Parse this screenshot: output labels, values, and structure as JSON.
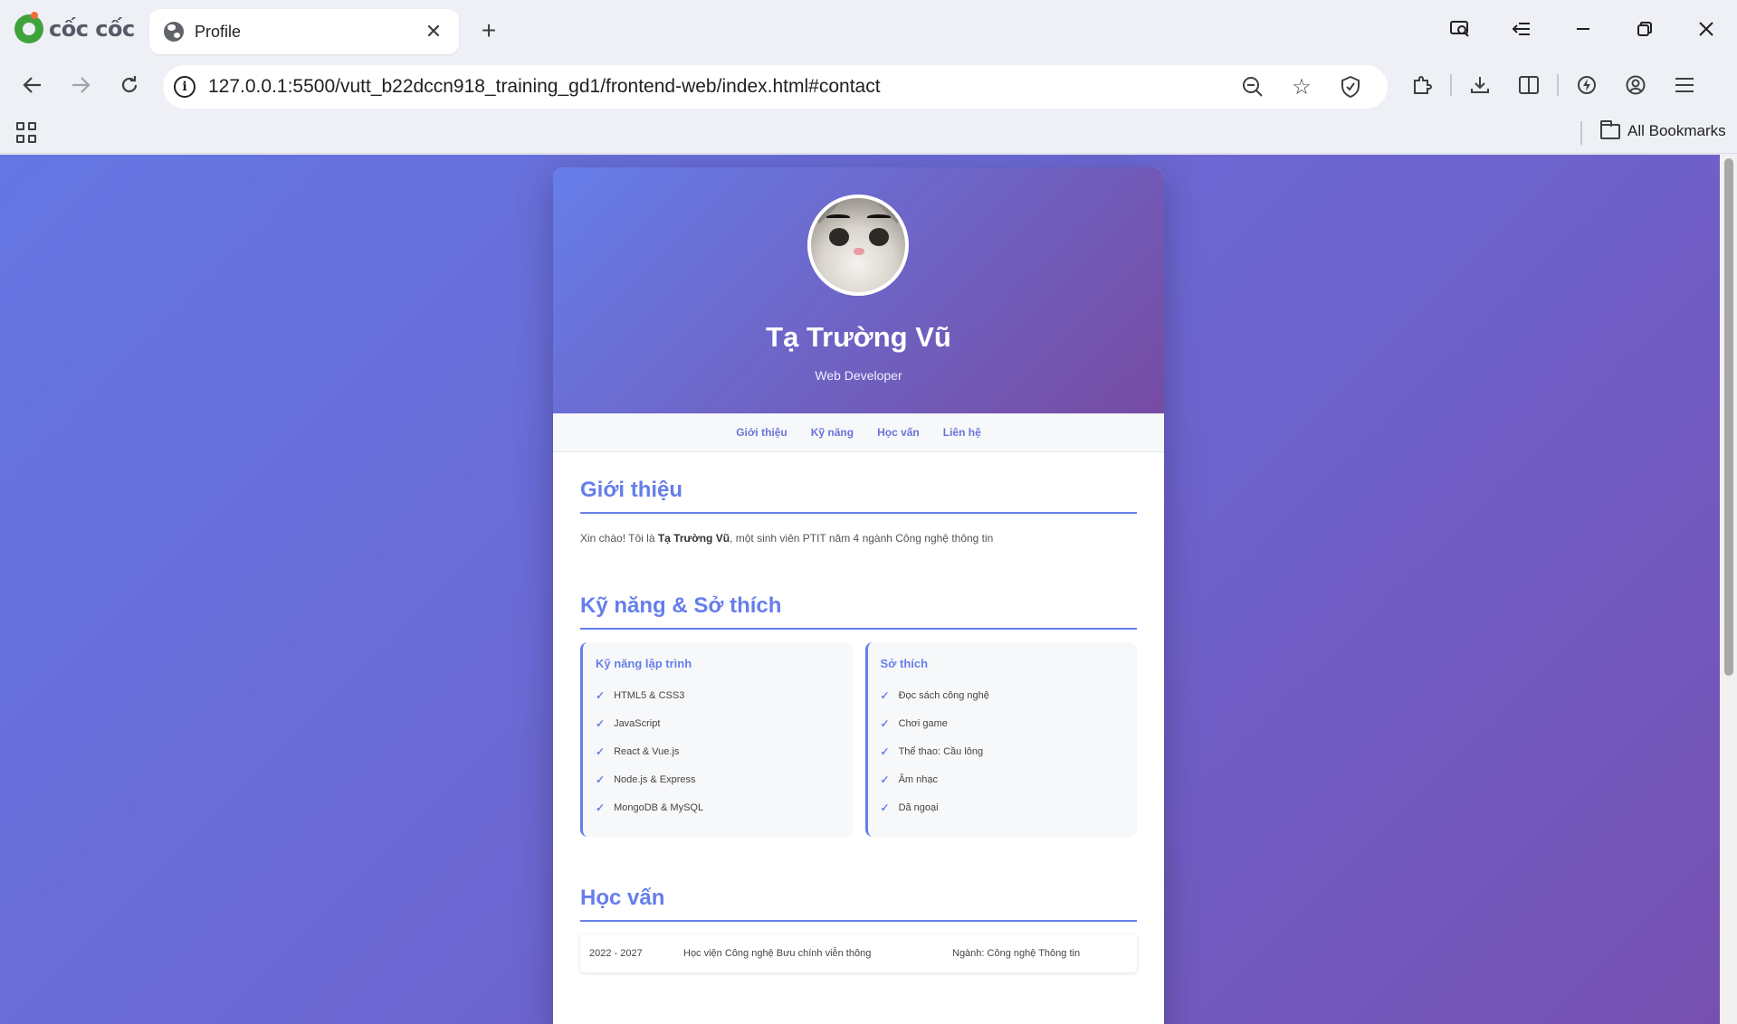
{
  "browser": {
    "brand": "cốc cốc",
    "tab_title": "Profile",
    "url": "127.0.0.1:5500/vutt_b22dccn918_training_gd1/frontend-web/index.html#contact",
    "all_bookmarks": "All Bookmarks"
  },
  "profile": {
    "name": "Tạ Trường Vũ",
    "role": "Web Developer"
  },
  "nav": {
    "items": [
      "Giới thiệu",
      "Kỹ năng",
      "Học vấn",
      "Liên hệ"
    ]
  },
  "intro": {
    "title": "Giới thiệu",
    "text_before": "Xin chào! Tôi là ",
    "name_bold": "Tạ Trường Vũ",
    "text_after": ", một sinh viên PTIT năm 4 ngành Công nghệ thông tin"
  },
  "skills": {
    "title": "Kỹ năng & Sở thích",
    "programming": {
      "heading": "Kỹ năng lập trình",
      "items": [
        "HTML5 & CSS3",
        "JavaScript",
        "React & Vue.js",
        "Node.js & Express",
        "MongoDB & MySQL"
      ]
    },
    "hobbies": {
      "heading": "Sở thích",
      "items": [
        "Đọc sách công nghệ",
        "Chơi game",
        "Thể thao: Cầu lông",
        "Âm nhạc",
        "Dã ngoại"
      ]
    },
    "check_symbol": "✓"
  },
  "education": {
    "title": "Học vấn",
    "rows": [
      {
        "years": "2022 - 2027",
        "school": "Học viện Công nghệ Bưu chính viễn thông",
        "major": "Ngành: Công nghệ Thông tin"
      }
    ]
  },
  "colors": {
    "accent": "#667eea",
    "gradient_start": "#667eea",
    "gradient_end": "#764ba2"
  }
}
